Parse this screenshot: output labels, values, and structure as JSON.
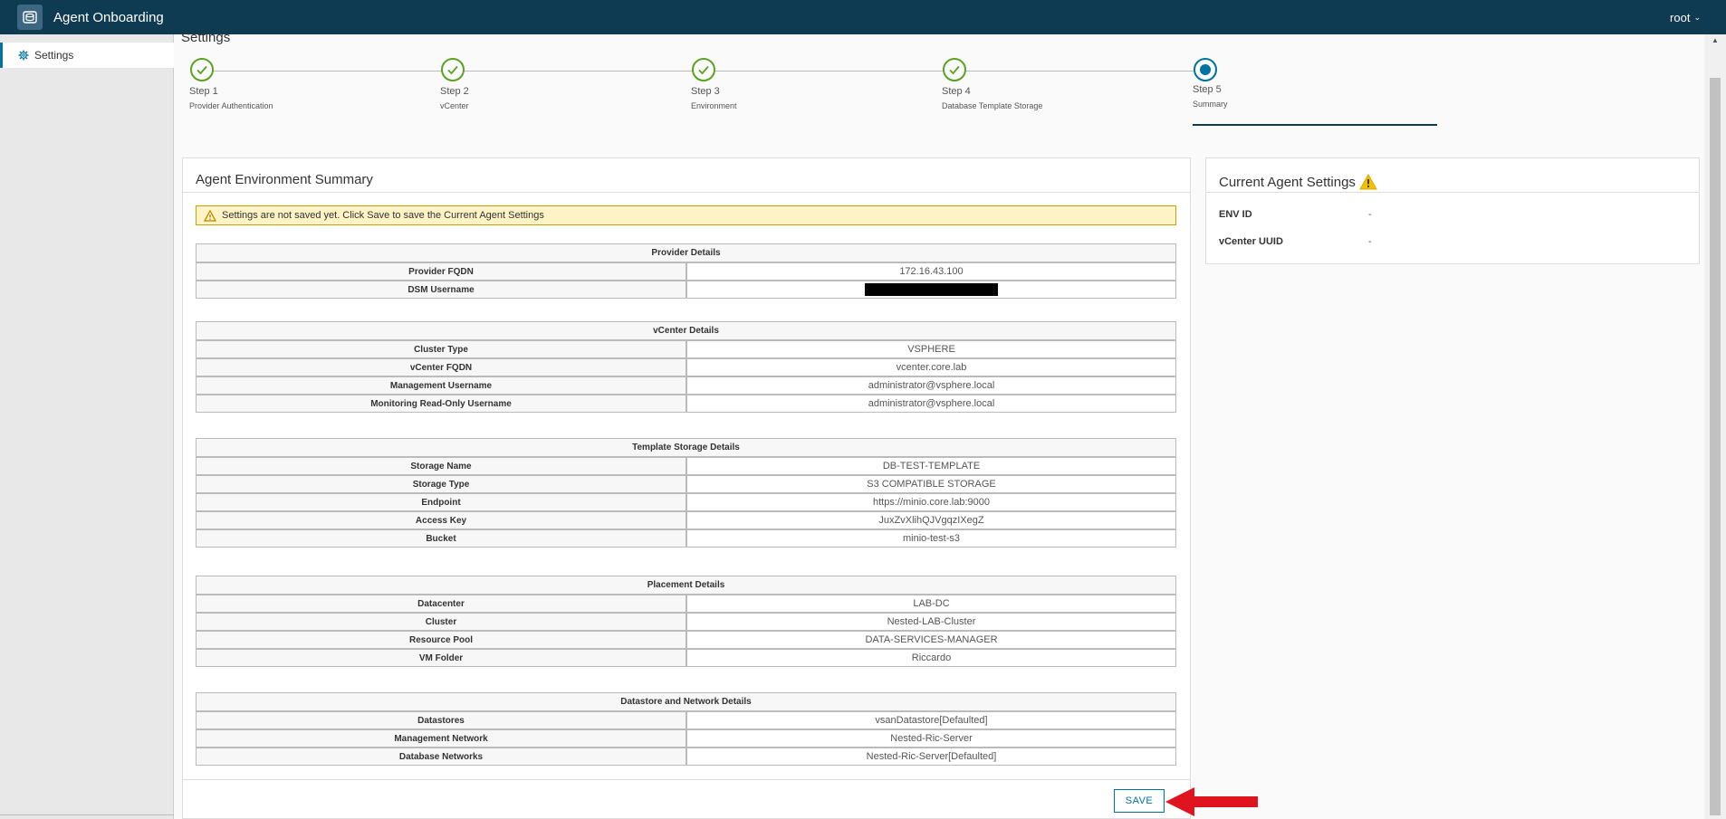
{
  "header": {
    "app_title": "Agent Onboarding",
    "user": "root",
    "user_chevron": "⌄"
  },
  "sidebar": {
    "items": [
      {
        "label": "Settings",
        "icon": "gear-icon"
      }
    ]
  },
  "page": {
    "title": "Settings"
  },
  "stepper": {
    "steps": [
      {
        "number": "Step 1",
        "label": "Provider Authentication",
        "status": "complete"
      },
      {
        "number": "Step 2",
        "label": "vCenter",
        "status": "complete"
      },
      {
        "number": "Step 3",
        "label": "Environment",
        "status": "complete"
      },
      {
        "number": "Step 4",
        "label": "Database Template Storage",
        "status": "complete"
      },
      {
        "number": "Step 5",
        "label": "Summary",
        "status": "current"
      }
    ]
  },
  "summary": {
    "title": "Agent Environment Summary",
    "warning": "Settings are not saved yet. Click Save to save the Current Agent Settings",
    "sections": [
      {
        "title": "Provider Details",
        "rows": [
          {
            "key": "Provider FQDN",
            "value": "172.16.43.100"
          },
          {
            "key": "DSM Username",
            "value": ""
          }
        ]
      },
      {
        "title": "vCenter Details",
        "rows": [
          {
            "key": "Cluster Type",
            "value": "VSPHERE"
          },
          {
            "key": "vCenter FQDN",
            "value": "vcenter.core.lab"
          },
          {
            "key": "Management Username",
            "value": "administrator@vsphere.local"
          },
          {
            "key": "Monitoring Read-Only Username",
            "value": "administrator@vsphere.local"
          }
        ]
      },
      {
        "title": "Template Storage Details",
        "rows": [
          {
            "key": "Storage Name",
            "value": "DB-TEST-TEMPLATE"
          },
          {
            "key": "Storage Type",
            "value": "S3 COMPATIBLE STORAGE"
          },
          {
            "key": "Endpoint",
            "value": "https://minio.core.lab:9000"
          },
          {
            "key": "Access Key",
            "value": "JuxZvXlihQJVgqzIXegZ"
          },
          {
            "key": "Bucket",
            "value": "minio-test-s3"
          }
        ]
      },
      {
        "title": "Placement Details",
        "rows": [
          {
            "key": "Datacenter",
            "value": "LAB-DC"
          },
          {
            "key": "Cluster",
            "value": "Nested-LAB-Cluster"
          },
          {
            "key": "Resource Pool",
            "value": "DATA-SERVICES-MANAGER"
          },
          {
            "key": "VM Folder",
            "value": "Riccardo"
          }
        ]
      },
      {
        "title": "Datastore and Network Details",
        "rows": [
          {
            "key": "Datastores",
            "value": "vsanDatastore[Defaulted]"
          },
          {
            "key": "Management Network",
            "value": "Nested-Ric-Server"
          },
          {
            "key": "Database Networks",
            "value": "Nested-Ric-Server[Defaulted]"
          }
        ]
      }
    ],
    "save_label": "SAVE"
  },
  "current_settings": {
    "title": "Current Agent Settings",
    "rows": [
      {
        "key": "ENV ID",
        "value": "-"
      },
      {
        "key": "vCenter UUID",
        "value": "-"
      }
    ]
  },
  "colors": {
    "header_bg": "#0e3a52",
    "accent": "#0072a3",
    "success": "#5aa220",
    "warning_bg": "#fdf3c4",
    "annotation_arrow": "#e0141e"
  }
}
